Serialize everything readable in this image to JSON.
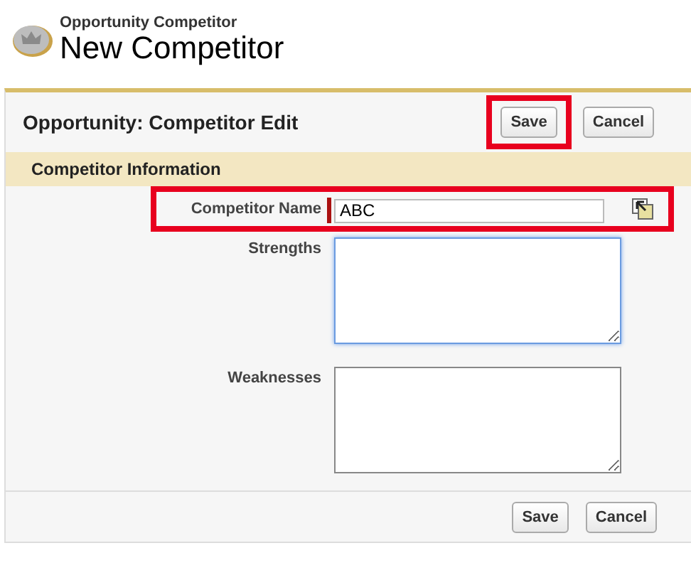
{
  "header": {
    "subtitle": "Opportunity Competitor",
    "title": "New Competitor"
  },
  "panel": {
    "title": "Opportunity: Competitor Edit",
    "top_buttons": [
      {
        "label": "Save",
        "highlighted": true
      },
      {
        "label": "Cancel",
        "highlighted": false
      }
    ],
    "section": "Competitor Information",
    "fields": [
      {
        "kind": "text",
        "label": "Competitor Name",
        "value": "ABC",
        "required": true,
        "highlighted": true,
        "focused": false
      },
      {
        "kind": "textarea",
        "label": "Strengths",
        "required": false,
        "highlighted": false,
        "focused": true
      },
      {
        "kind": "textarea",
        "label": "Weaknesses",
        "required": false,
        "highlighted": false,
        "focused": false
      }
    ],
    "bottom_buttons": [
      {
        "label": "Save",
        "highlighted": false
      },
      {
        "label": "Cancel",
        "highlighted": false
      }
    ]
  }
}
